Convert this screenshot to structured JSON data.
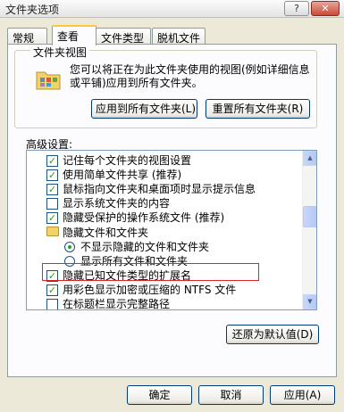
{
  "window": {
    "title": "文件夹选项",
    "help_glyph": "?",
    "close_glyph": "✕"
  },
  "tabs": [
    "常规",
    "查看",
    "文件类型",
    "脱机文件"
  ],
  "folder_views": {
    "legend": "文件夹视图",
    "description": "您可以将正在为此文件夹使用的视图(例如详细信息或平铺)应用到所有文件夹。",
    "apply_all_label": "应用到所有文件夹(L)",
    "reset_all_label": "重置所有文件夹(R)"
  },
  "advanced": {
    "label": "高级设置:",
    "items": [
      {
        "kind": "checkbox",
        "checked": true,
        "text": "记住每个文件夹的视图设置"
      },
      {
        "kind": "checkbox",
        "checked": true,
        "text": "使用简单文件共享 (推荐)"
      },
      {
        "kind": "checkbox",
        "checked": true,
        "text": "鼠标指向文件夹和桌面项时显示提示信息"
      },
      {
        "kind": "checkbox",
        "checked": false,
        "text": "显示系统文件夹的内容"
      },
      {
        "kind": "checkbox",
        "checked": true,
        "text": "隐藏受保护的操作系统文件 (推荐)"
      },
      {
        "kind": "folder",
        "checked": false,
        "text": "隐藏文件和文件夹"
      },
      {
        "kind": "radio",
        "checked": true,
        "text": "不显示隐藏的文件和文件夹"
      },
      {
        "kind": "radio",
        "checked": false,
        "text": "显示所有文件和文件夹"
      },
      {
        "kind": "checkbox",
        "checked": true,
        "text": "隐藏已知文件类型的扩展名"
      },
      {
        "kind": "checkbox",
        "checked": true,
        "text": "用彩色显示加密或压缩的 NTFS 文件"
      },
      {
        "kind": "checkbox",
        "checked": false,
        "text": "在标题栏显示完整路径"
      }
    ]
  },
  "buttons": {
    "restore_defaults": "还原为默认值(D)",
    "ok": "确定",
    "cancel": "取消",
    "apply": "应用(A)"
  },
  "colors": {
    "highlight_border": "#d8262b",
    "check": "#21a121",
    "tab_accent": "#ffc83c"
  }
}
